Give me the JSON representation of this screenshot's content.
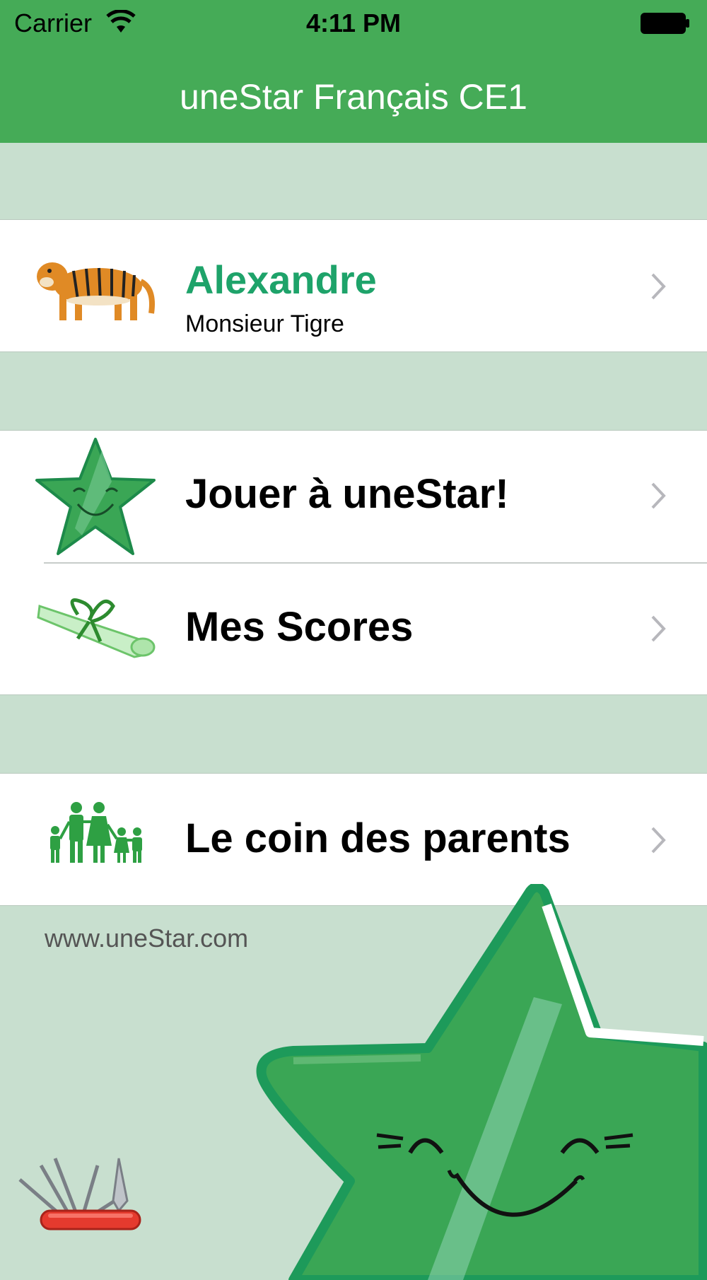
{
  "status_bar": {
    "carrier": "Carrier",
    "time": "4:11 PM",
    "wifi_icon": "wifi-icon",
    "battery_icon": "battery-icon"
  },
  "nav": {
    "title": "uneStar Français CE1"
  },
  "profile": {
    "name": "Alexandre",
    "subtitle": "Monsieur Tigre",
    "icon": "tiger-icon",
    "name_color": "#1ea36a"
  },
  "menu": [
    {
      "label": "Jouer à uneStar!",
      "icon": "star-icon"
    },
    {
      "label": "Mes Scores",
      "icon": "diploma-icon"
    },
    {
      "label": "Le coin des parents",
      "icon": "family-icon"
    }
  ],
  "footer": {
    "link": "www.uneStar.com",
    "tools_icon": "swiss-army-knife-icon",
    "mascot_icon": "star-mascot-icon"
  },
  "colors": {
    "nav_green": "#45ab57",
    "background": "#c8dfcf",
    "star_green": "#3aa655"
  }
}
